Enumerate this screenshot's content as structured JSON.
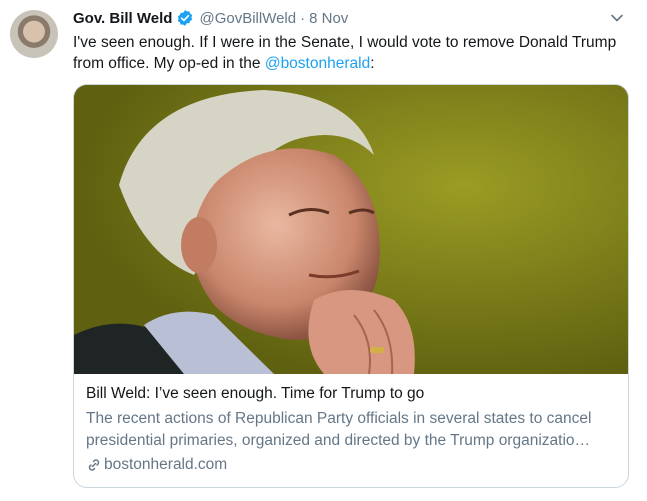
{
  "tweet": {
    "author_name": "Gov. Bill Weld",
    "handle": "@GovBillWeld",
    "separator": "·",
    "date": "8 Nov",
    "text_before": "I've seen enough. If I were in the Senate, I would vote to remove Donald Trump from office. My op-ed in the ",
    "mention": "@bostonherald",
    "text_after": ":"
  },
  "card": {
    "title": "Bill Weld: I’ve seen enough. Time for Trump to go",
    "description": "The recent actions of Republican Party officials in several states to cancel presidential primaries, organized and directed by the Trump organizatio…",
    "domain": "bostonherald.com"
  },
  "icons": {
    "verified": "verified-badge-icon",
    "chevron": "chevron-down-icon",
    "link": "link-icon"
  },
  "colors": {
    "accent": "#1da1f2",
    "secondary_text": "#657786",
    "border": "#ccd6dd"
  }
}
